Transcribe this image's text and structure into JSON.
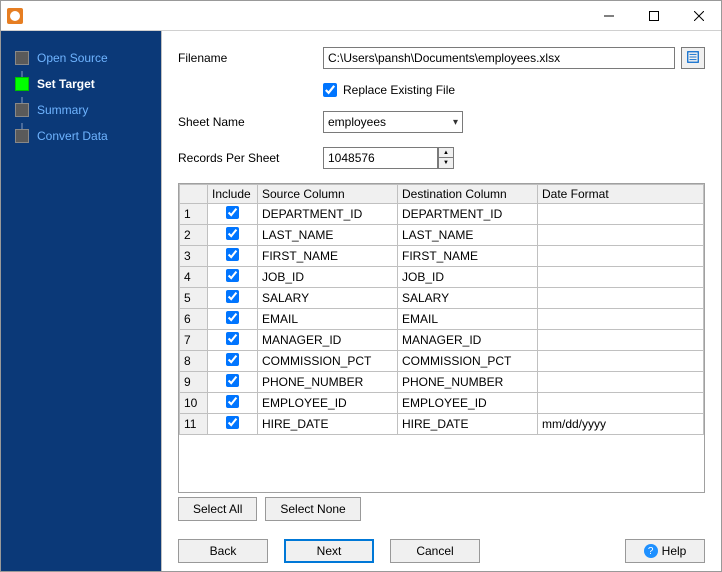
{
  "sidebar": {
    "steps": [
      {
        "label": "Open Source",
        "active": false
      },
      {
        "label": "Set Target",
        "active": true
      },
      {
        "label": "Summary",
        "active": false
      },
      {
        "label": "Convert Data",
        "active": false
      }
    ]
  },
  "form": {
    "filename_label": "Filename",
    "filename_value": "C:\\Users\\pansh\\Documents\\employees.xlsx",
    "replace_label": "Replace Existing File",
    "replace_checked": true,
    "sheet_label": "Sheet Name",
    "sheet_value": "employees",
    "records_label": "Records Per Sheet",
    "records_value": "1048576"
  },
  "grid": {
    "headers": {
      "include": "Include",
      "source": "Source Column",
      "dest": "Destination Column",
      "format": "Date Format"
    },
    "rows": [
      {
        "n": "1",
        "inc": true,
        "src": "DEPARTMENT_ID",
        "dst": "DEPARTMENT_ID",
        "fmt": ""
      },
      {
        "n": "2",
        "inc": true,
        "src": "LAST_NAME",
        "dst": "LAST_NAME",
        "fmt": ""
      },
      {
        "n": "3",
        "inc": true,
        "src": "FIRST_NAME",
        "dst": "FIRST_NAME",
        "fmt": ""
      },
      {
        "n": "4",
        "inc": true,
        "src": "JOB_ID",
        "dst": "JOB_ID",
        "fmt": ""
      },
      {
        "n": "5",
        "inc": true,
        "src": "SALARY",
        "dst": "SALARY",
        "fmt": ""
      },
      {
        "n": "6",
        "inc": true,
        "src": "EMAIL",
        "dst": "EMAIL",
        "fmt": ""
      },
      {
        "n": "7",
        "inc": true,
        "src": "MANAGER_ID",
        "dst": "MANAGER_ID",
        "fmt": ""
      },
      {
        "n": "8",
        "inc": true,
        "src": "COMMISSION_PCT",
        "dst": "COMMISSION_PCT",
        "fmt": ""
      },
      {
        "n": "9",
        "inc": true,
        "src": "PHONE_NUMBER",
        "dst": "PHONE_NUMBER",
        "fmt": ""
      },
      {
        "n": "10",
        "inc": true,
        "src": "EMPLOYEE_ID",
        "dst": "EMPLOYEE_ID",
        "fmt": ""
      },
      {
        "n": "11",
        "inc": true,
        "src": "HIRE_DATE",
        "dst": "HIRE_DATE",
        "fmt": "mm/dd/yyyy"
      }
    ]
  },
  "buttons": {
    "select_all": "Select All",
    "select_none": "Select None",
    "back": "Back",
    "next": "Next",
    "cancel": "Cancel",
    "help": "Help"
  }
}
